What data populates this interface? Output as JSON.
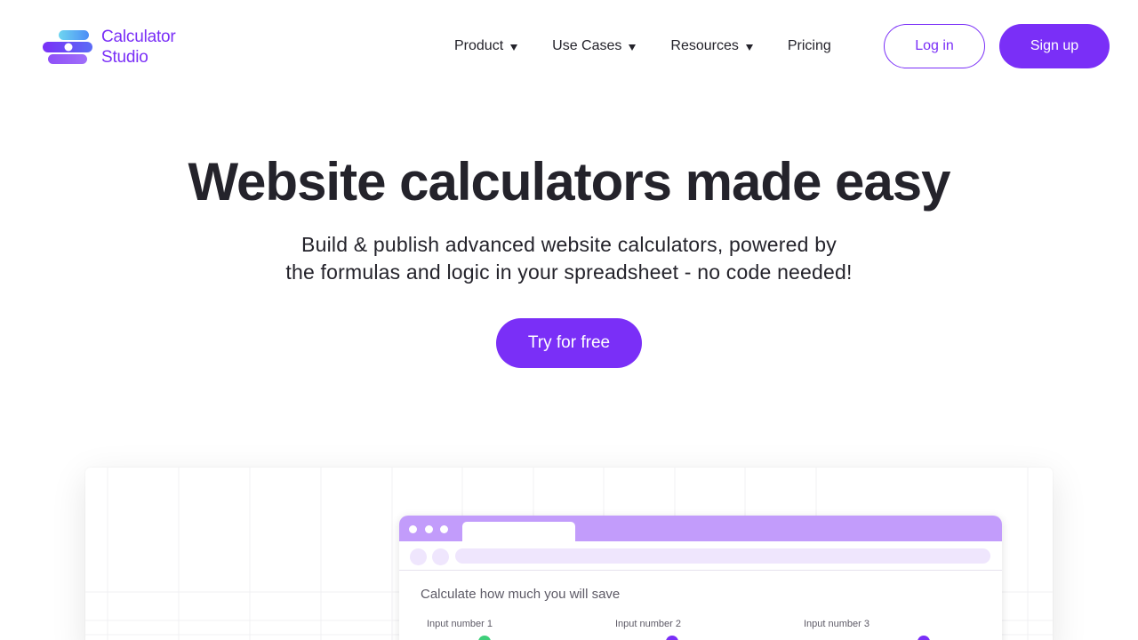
{
  "brand": {
    "line1": "Calculator",
    "line2": "Studio",
    "color": "#7a2ff7"
  },
  "nav": {
    "items": [
      {
        "label": "Product",
        "has_dropdown": true
      },
      {
        "label": "Use Cases",
        "has_dropdown": true
      },
      {
        "label": "Resources",
        "has_dropdown": true
      },
      {
        "label": "Pricing",
        "has_dropdown": false
      }
    ],
    "login_label": "Log in",
    "signup_label": "Sign up"
  },
  "hero": {
    "title": "Website calculators made easy",
    "subtitle_line1": "Build & publish advanced website calculators, powered by",
    "subtitle_line2": "the formulas and logic in your spreadsheet - no code needed!",
    "cta_label": "Try for free"
  },
  "preview": {
    "calc_title": "Calculate how much you will save",
    "inputs": [
      {
        "label": "Input number 1",
        "dot_color": "#3ecf7a"
      },
      {
        "label": "Input number 2",
        "dot_color": "#7a2ff7"
      },
      {
        "label": "Input number 3",
        "dot_color": "#7a2ff7"
      }
    ]
  },
  "colors": {
    "accent": "#7a2ff7",
    "browser_bar": "#c29cfb",
    "light_lavender": "#efe6fd",
    "text_dark": "#24232b"
  }
}
